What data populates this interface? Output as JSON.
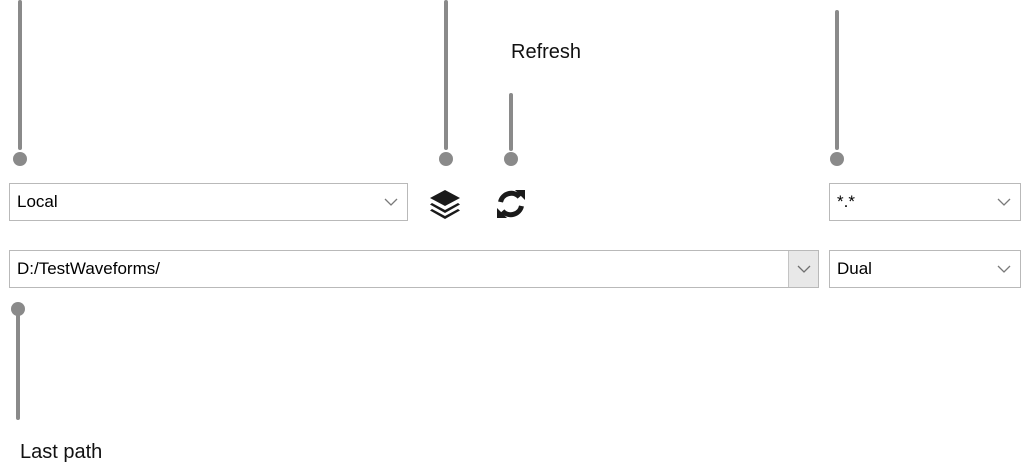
{
  "callouts": {
    "refresh": "Refresh",
    "last_path": "Last path"
  },
  "toolbar": {
    "source_select": {
      "value": "Local",
      "icon": "chevron-down-icon"
    },
    "layers_icon": "layers-icon",
    "refresh_icon": "refresh-icon",
    "filter_select": {
      "value": "*.*",
      "icon": "chevron-down-icon"
    }
  },
  "path_row": {
    "path_select": {
      "value": "D:/TestWaveforms/",
      "icon": "chevron-down-icon"
    },
    "mode_select": {
      "value": "Dual",
      "icon": "chevron-down-icon"
    }
  },
  "colors": {
    "callout": "#8a8a8a",
    "border": "#b9b9b9",
    "icon": "#1a1a1a"
  }
}
